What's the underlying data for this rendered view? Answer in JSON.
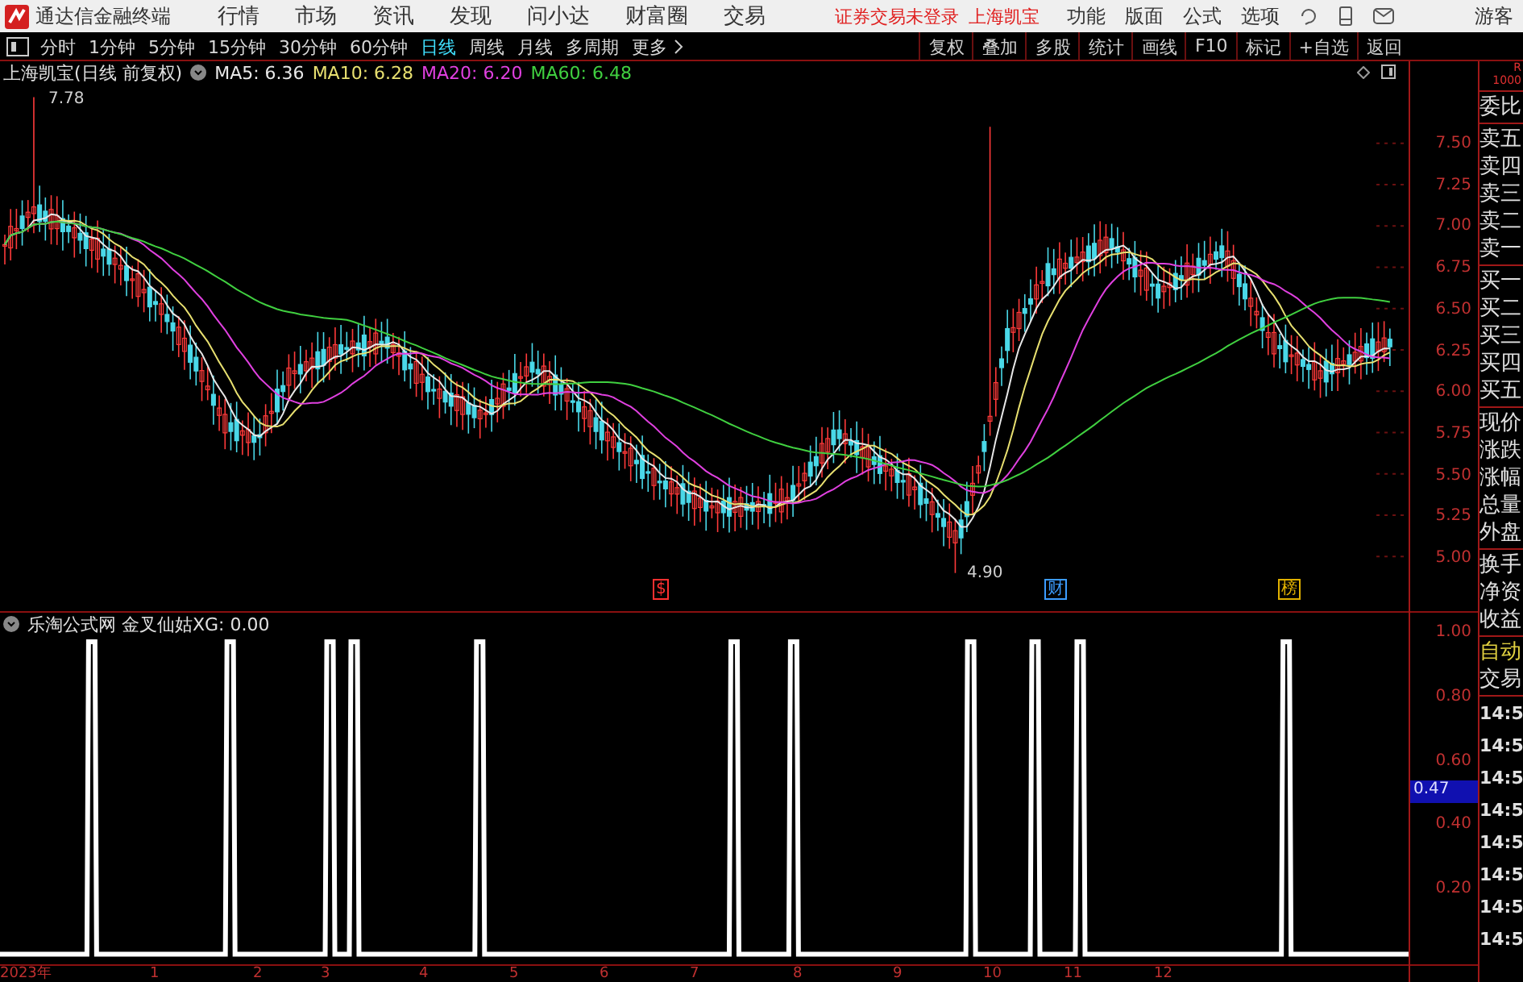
{
  "app": {
    "title": "通达信金融终端"
  },
  "menu": [
    "行情",
    "市场",
    "资讯",
    "发现",
    "问小达",
    "财富圈",
    "交易"
  ],
  "notice": "证券交易未登录",
  "stock_link": "上海凯宝",
  "right_menu": [
    "功能",
    "版面",
    "公式",
    "选项"
  ],
  "user": "游客",
  "periods": [
    {
      "label": "分时",
      "selected": false
    },
    {
      "label": "1分钟",
      "selected": false
    },
    {
      "label": "5分钟",
      "selected": false
    },
    {
      "label": "15分钟",
      "selected": false
    },
    {
      "label": "30分钟",
      "selected": false
    },
    {
      "label": "60分钟",
      "selected": false
    },
    {
      "label": "日线",
      "selected": true
    },
    {
      "label": "周线",
      "selected": false
    },
    {
      "label": "月线",
      "selected": false
    },
    {
      "label": "多周期",
      "selected": false
    }
  ],
  "more": "更多",
  "tools": [
    "复权",
    "叠加",
    "多股",
    "统计",
    "画线",
    "F10",
    "标记",
    "+自选",
    "返回"
  ],
  "main_chart": {
    "title": "上海凯宝(日线 前复权)",
    "indicators": [
      {
        "label": "MA5: 6.36",
        "color": "#e8e8e8"
      },
      {
        "label": "MA10: 6.28",
        "color": "#e8e070"
      },
      {
        "label": "MA20: 6.20",
        "color": "#e040e0"
      },
      {
        "label": "MA60: 6.48",
        "color": "#40d040"
      }
    ],
    "high_label": "7.78",
    "low_label": "4.90",
    "event_marks": [
      {
        "text": "$",
        "color": "#ff3030"
      },
      {
        "text": "财",
        "color": "#3c9cff"
      },
      {
        "text": "榜",
        "color": "#e0b000"
      }
    ],
    "price_ticks": [
      "7.50",
      "7.25",
      "7.00",
      "6.75",
      "6.50",
      "6.25",
      "6.00",
      "5.75",
      "5.50",
      "5.25",
      "5.00"
    ]
  },
  "indicator_chart": {
    "title": "乐淘公式网 金叉仙姑XG: 0.00",
    "ticks": [
      "1.00",
      "0.80",
      "0.60",
      "0.40",
      "0.20"
    ],
    "cursor_value": "0.47"
  },
  "time_axis": [
    "2023年",
    "1",
    "2",
    "3",
    "4",
    "5",
    "6",
    "7",
    "8",
    "9",
    "10",
    "11",
    "12"
  ],
  "side_panel": {
    "header": [
      "R",
      "1000"
    ],
    "groups": [
      [
        {
          "text": "委比",
          "kind": "label"
        }
      ],
      [
        {
          "text": "卖五",
          "kind": "label"
        },
        {
          "text": "卖四",
          "kind": "label"
        },
        {
          "text": "卖三",
          "kind": "label"
        },
        {
          "text": "卖二",
          "kind": "label"
        },
        {
          "text": "卖一",
          "kind": "label"
        }
      ],
      [
        {
          "text": "买一",
          "kind": "label"
        },
        {
          "text": "买二",
          "kind": "label"
        },
        {
          "text": "买三",
          "kind": "label"
        },
        {
          "text": "买四",
          "kind": "label"
        },
        {
          "text": "买五",
          "kind": "label"
        }
      ],
      [
        {
          "text": "现价",
          "kind": "label"
        },
        {
          "text": "涨跌",
          "kind": "label"
        },
        {
          "text": "涨幅",
          "kind": "label"
        },
        {
          "text": "总量",
          "kind": "label"
        },
        {
          "text": "外盘",
          "kind": "label"
        }
      ],
      [
        {
          "text": "换手",
          "kind": "label"
        },
        {
          "text": "净资",
          "kind": "label"
        },
        {
          "text": "收益",
          "kind": "label"
        }
      ],
      [
        {
          "text": "自动",
          "kind": "mode"
        },
        {
          "text": "交易",
          "kind": "label"
        }
      ],
      [
        {
          "text": "14:5",
          "kind": "time"
        },
        {
          "text": "14:5",
          "kind": "time"
        },
        {
          "text": "14:5",
          "kind": "time"
        },
        {
          "text": "14:5",
          "kind": "time"
        },
        {
          "text": "14:5",
          "kind": "time"
        },
        {
          "text": "14:5",
          "kind": "time"
        },
        {
          "text": "14:5",
          "kind": "time"
        },
        {
          "text": "14:5",
          "kind": "time"
        }
      ]
    ]
  }
}
